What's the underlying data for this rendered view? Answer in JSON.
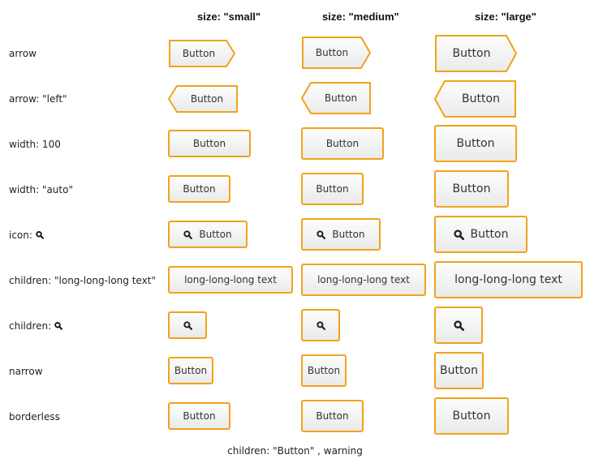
{
  "headers": {
    "small": "size: \"small\"",
    "medium": "size: \"medium\"",
    "large": "size: \"large\""
  },
  "rows": {
    "arrow": "arrow",
    "arrow_left": "arrow: \"left\"",
    "width": "width: 100",
    "width_auto": "width: \"auto\"",
    "icon": "icon:",
    "children_long": "children: \"long-long-long text\"",
    "children_icon": "children:",
    "narrow": "narrow",
    "borderless": "borderless"
  },
  "button_label": "Button",
  "long_label": "long-long-long text",
  "icon_name": "search-icon",
  "footer": "children: \"Button\" , warning",
  "colors": {
    "border": "#f2a21a",
    "bg_top": "#fdfdfd",
    "bg_bottom": "#eaeaea"
  }
}
